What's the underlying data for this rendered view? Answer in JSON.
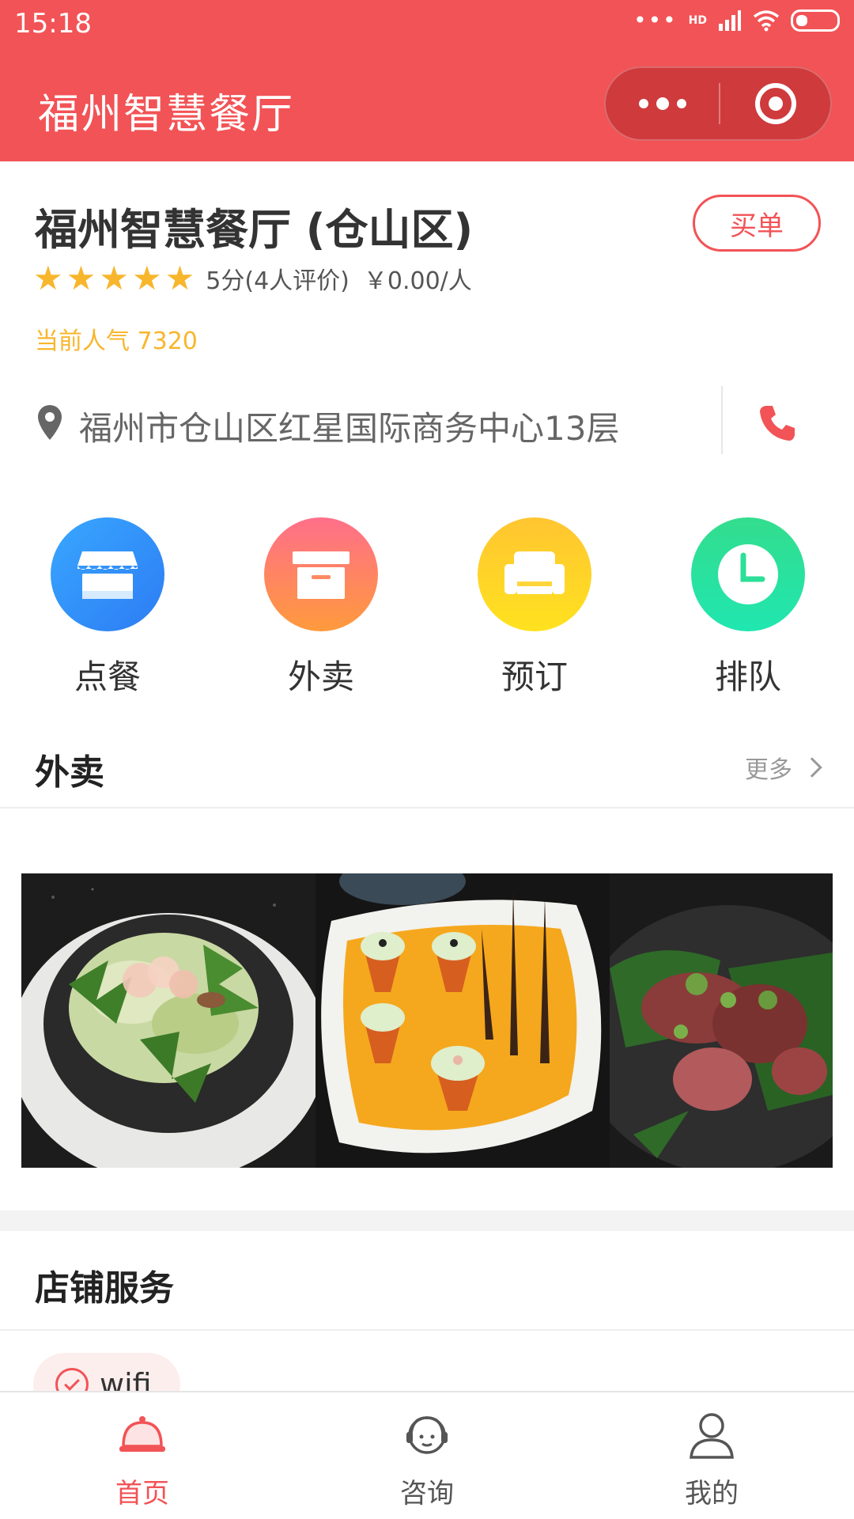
{
  "status_bar": {
    "time": "15:18",
    "network": "HD"
  },
  "navbar": {
    "title": "福州智慧餐厅"
  },
  "store": {
    "name": "福州智慧餐厅 (仓山区)",
    "pay_label": "买单",
    "rating_stars": 5,
    "rating_text": "5分(4人评价)",
    "price_text": "￥0.00/人",
    "popularity": "当前人气 7320",
    "address": "福州市仓山区红星国际商务中心13层"
  },
  "actions": [
    {
      "label": "点餐",
      "icon": "shop-icon"
    },
    {
      "label": "外卖",
      "icon": "box-icon"
    },
    {
      "label": "预订",
      "icon": "sofa-icon"
    },
    {
      "label": "排队",
      "icon": "clock-icon"
    }
  ],
  "takeout": {
    "title": "外卖",
    "more_label": "更多",
    "photos": [
      "salad-dish-photo",
      "orange-plate-dish-photo",
      "steak-dish-photo"
    ]
  },
  "services": {
    "title": "店铺服务",
    "items": [
      {
        "label": "wifi",
        "icon": "check-circle-icon"
      }
    ]
  },
  "tabbar": {
    "items": [
      {
        "label": "首页",
        "icon": "cloche-icon",
        "active": true
      },
      {
        "label": "咨询",
        "icon": "support-agent-icon",
        "active": false
      },
      {
        "label": "我的",
        "icon": "user-icon",
        "active": false
      }
    ]
  },
  "colors": {
    "brand": "#f25356",
    "star": "#f8b62d",
    "popularity": "#f8b62d"
  }
}
